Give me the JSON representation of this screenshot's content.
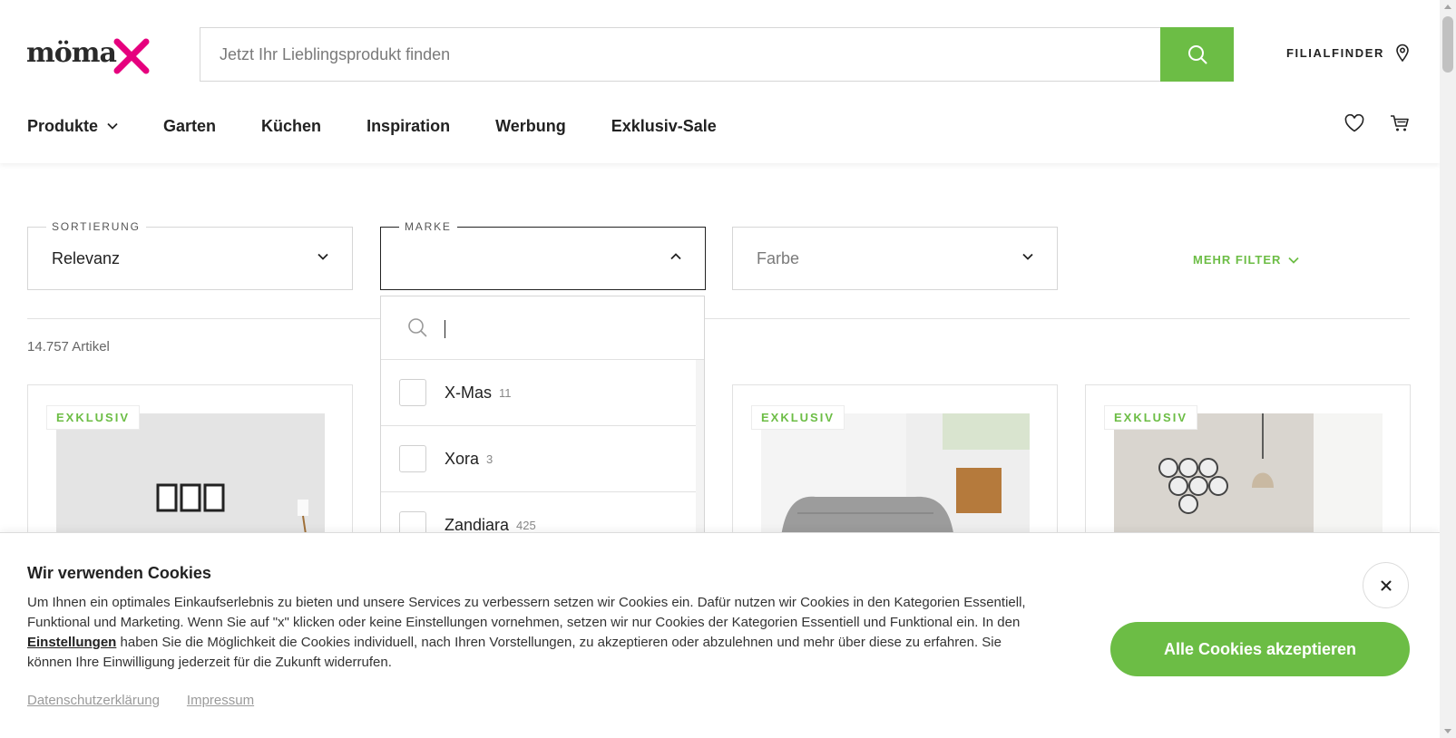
{
  "logo": {
    "text": "möma"
  },
  "search": {
    "placeholder": "Jetzt Ihr Lieblingsprodukt finden",
    "value": ""
  },
  "header": {
    "filialfinder": "FILIALFINDER"
  },
  "nav": [
    {
      "label": "Produkte"
    },
    {
      "label": "Garten"
    },
    {
      "label": "Küchen"
    },
    {
      "label": "Inspiration"
    },
    {
      "label": "Werbung"
    },
    {
      "label": "Exklusiv-Sale"
    }
  ],
  "filters": {
    "sort": {
      "legend": "SORTIERUNG",
      "value": "Relevanz"
    },
    "brand": {
      "legend": "MARKE",
      "value": ""
    },
    "color": {
      "placeholder": "Farbe"
    },
    "more": "MEHR FILTER"
  },
  "results": {
    "count": "14.757 Artikel"
  },
  "brand_dropdown": {
    "search_value": "",
    "items": [
      {
        "label": "X-Mas",
        "count": "11"
      },
      {
        "label": "Xora",
        "count": "3"
      },
      {
        "label": "Zandiara",
        "count": "425"
      }
    ]
  },
  "cards": [
    {
      "badge": "EXKLUSIV"
    },
    {
      "badge": "EXKLUSIV"
    },
    {
      "badge": "EXKLUSIV"
    }
  ],
  "cookie": {
    "title": "Wir verwenden Cookies",
    "text_before": "Um Ihnen ein optimales Einkaufserlebnis zu bieten und unsere Services zu verbessern setzen wir Cookies ein. Dafür nutzen wir Cookies in den Kategorien Essentiell, Funktional und Marketing. Wenn Sie auf \"x\" klicken oder keine Einstellungen vornehmen, setzen wir nur Cookies der Kategorien Essentiell und Funktional ein. In den ",
    "settings_link": "Einstellungen",
    "text_after": " haben Sie die Möglichkeit die Cookies individuell, nach Ihren Vorstellungen, zu akzeptieren oder abzulehnen und mehr über diese zu erfahren. Sie können Ihre Einwilligung jederzeit für die Zukunft widerrufen.",
    "privacy": "Datenschutzerklärung",
    "imprint": "Impressum",
    "accept": "Alle Cookies akzeptieren",
    "close": "×"
  },
  "colors": {
    "brand_green": "#6cbd45",
    "logo_pink": "#e6007e"
  }
}
